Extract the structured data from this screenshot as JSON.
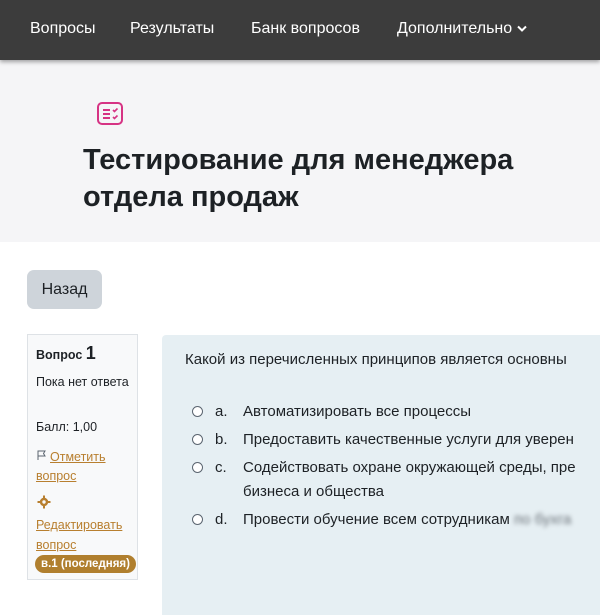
{
  "nav": {
    "items": [
      "Вопросы",
      "Результаты",
      "Банк вопросов"
    ],
    "more_label": "Дополнительно"
  },
  "header": {
    "icon": "quiz-list-icon",
    "title": "Тестирование для менеджера отдела продаж",
    "accent_color": "#d63384"
  },
  "back_button": {
    "label": "Назад"
  },
  "question_info": {
    "label": "Вопрос",
    "number": "1",
    "state": "Пока нет ответа",
    "grade": "Балл: 1,00",
    "flag_link": "Отметить вопрос",
    "edit_link": "Редактировать вопрос",
    "version_badge": "в.1 (последняя)"
  },
  "question": {
    "text": "Какой из перечисленных принципов является основны",
    "options": [
      {
        "letter": "a.",
        "text": "Автоматизировать все процессы"
      },
      {
        "letter": "b.",
        "text": "Предоставить качественные услуги для уверен"
      },
      {
        "letter": "c.",
        "text": "Содействовать охране окружающей среды, пре",
        "text_line2": "бизнеса и общества"
      },
      {
        "letter": "d.",
        "text": "Провести обучение всем сотрудникам",
        "text_blurred": "по бухга"
      }
    ]
  }
}
